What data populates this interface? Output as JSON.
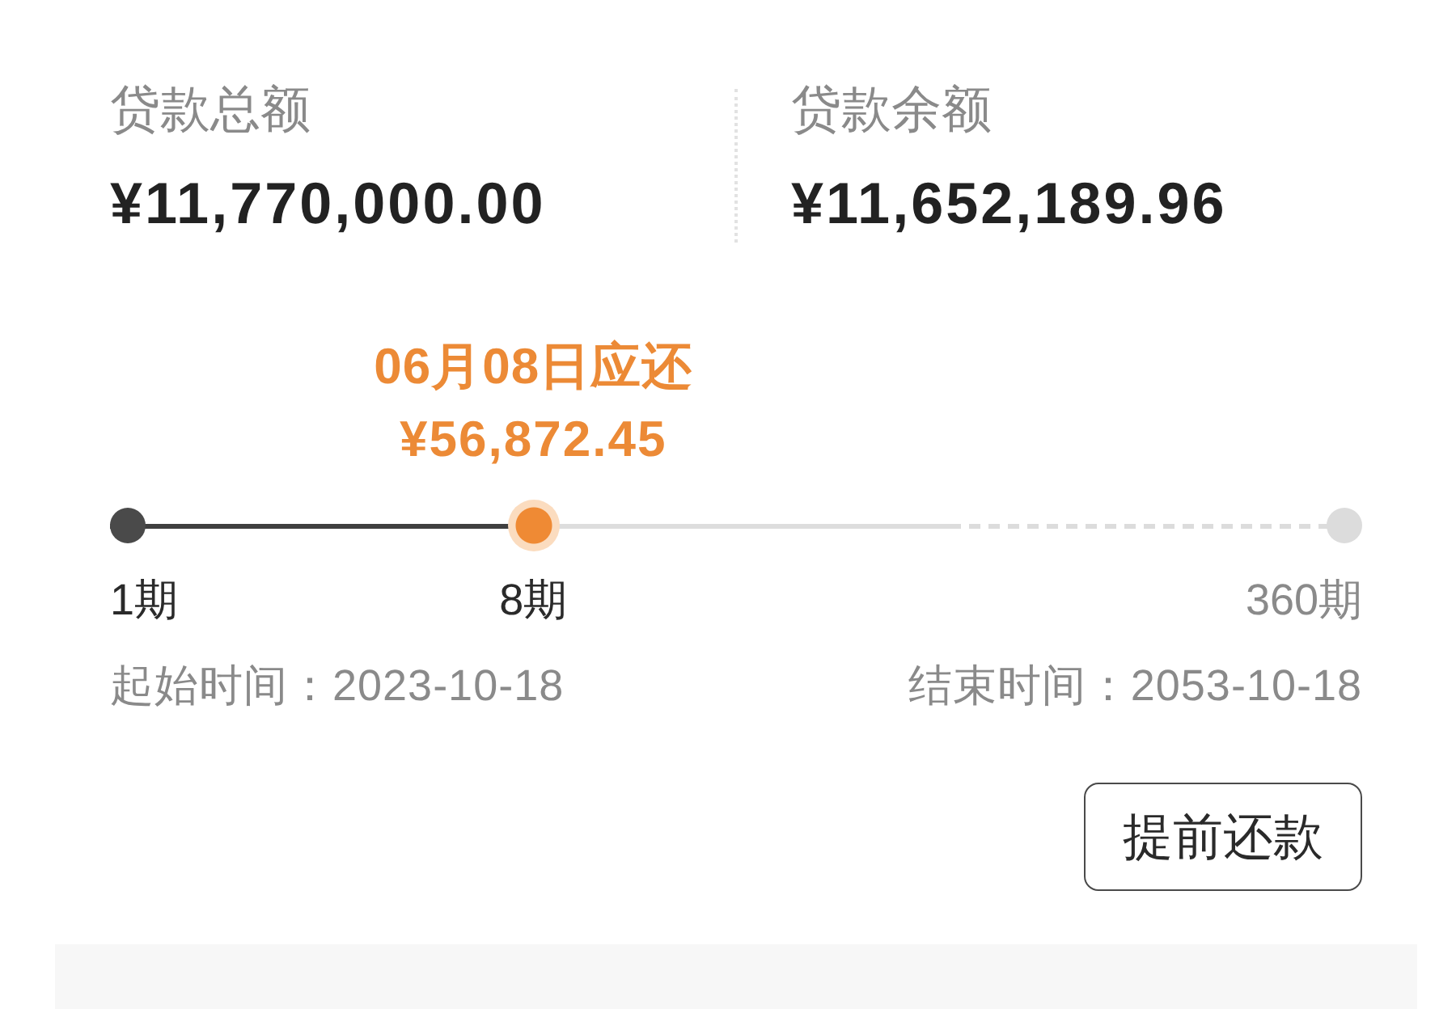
{
  "summary": [
    {
      "label": "贷款总额",
      "value": "¥11,770,000.00"
    },
    {
      "label": "贷款余额",
      "value": "¥11,652,189.96"
    }
  ],
  "schedule": {
    "due_date": "06月08日应还",
    "due_amount": "¥56,872.45",
    "level": 0.338,
    "markers": [
      {
        "kind": "start",
        "label": "1期",
        "reached": true
      },
      {
        "kind": "current",
        "label": "8期",
        "reached": true
      },
      {
        "kind": "end",
        "label": "360期",
        "reached": false
      }
    ],
    "start_date": "起始时间：2023-10-18",
    "end_date": "结束时间：2053-10-18"
  },
  "prepay_button": "提前还款"
}
